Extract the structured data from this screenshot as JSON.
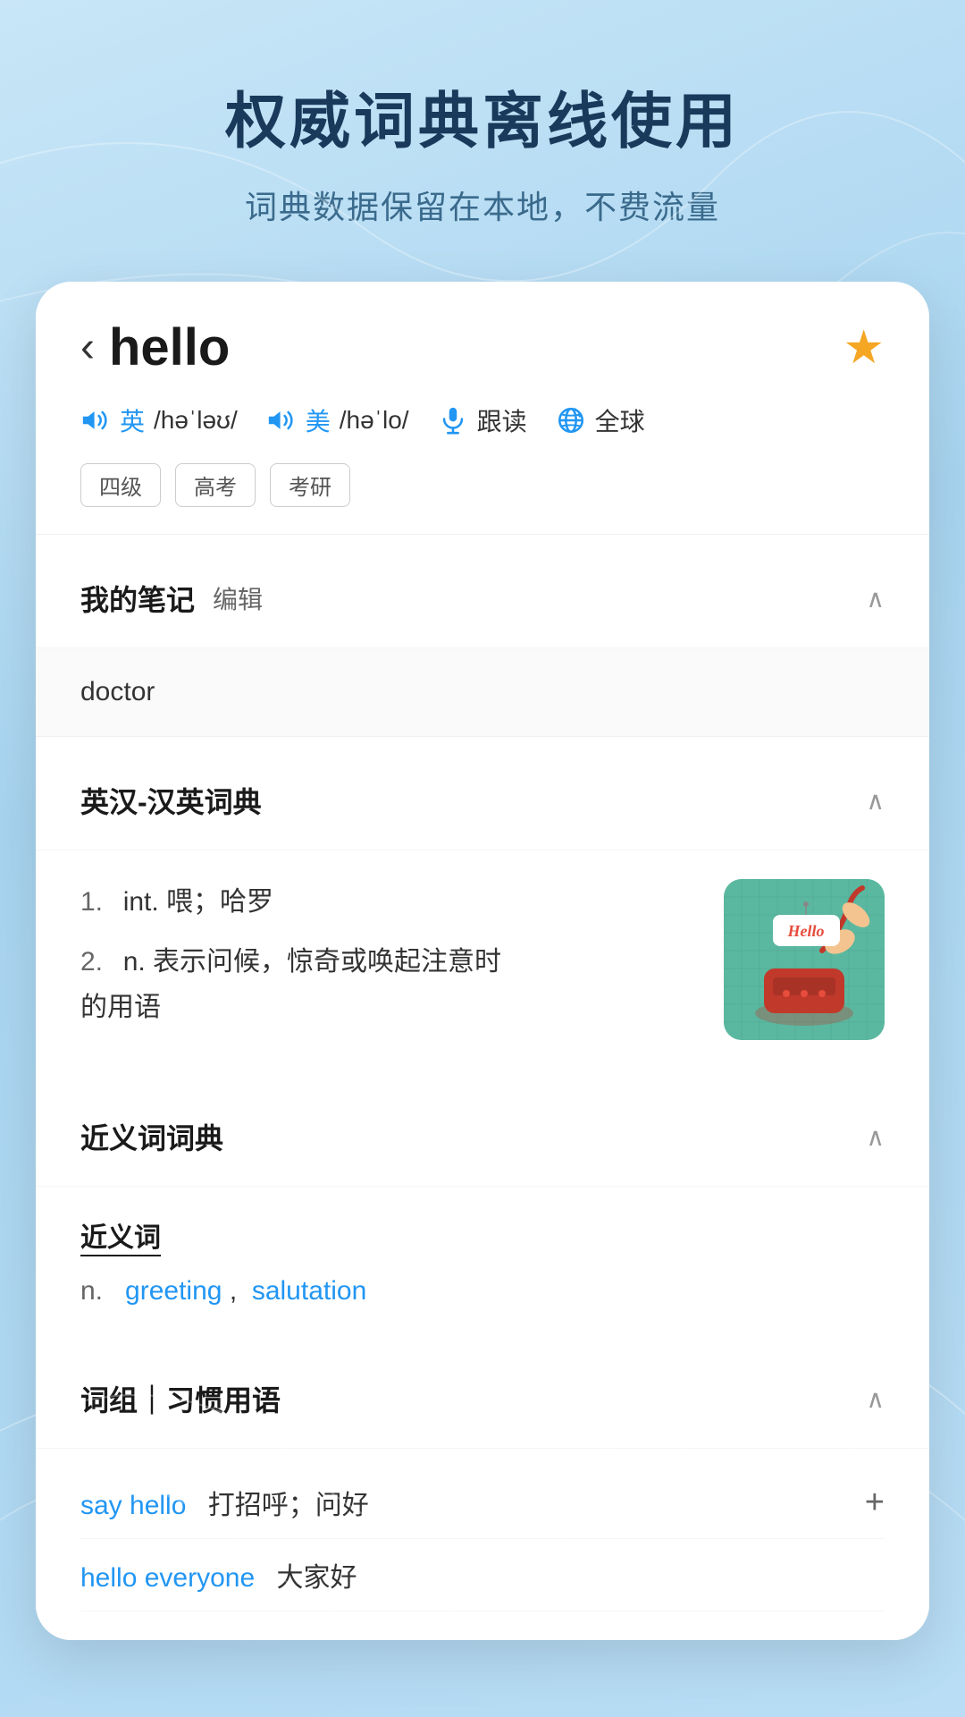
{
  "background": {
    "color_start": "#c8e6f7",
    "color_end": "#a8d4f0"
  },
  "header": {
    "main_title": "权威词典离线使用",
    "sub_title": "词典数据保留在本地，不费流量"
  },
  "word_card": {
    "back_label": "‹",
    "word": "hello",
    "star_icon": "★",
    "pronunciation": {
      "uk_label": "英",
      "uk_phonetic": "/həˈləʊ/",
      "us_label": "美",
      "us_phonetic": "/həˈlo/",
      "follow_read_label": "跟读",
      "global_label": "全球"
    },
    "tags": [
      "四级",
      "高考",
      "考研"
    ],
    "sections": {
      "notes": {
        "title": "我的笔记",
        "edit_label": "编辑",
        "content": "doctor"
      },
      "en_zh_dict": {
        "title": "英汉-汉英词典",
        "definitions": [
          {
            "num": "1.",
            "pos": "int.",
            "text": "喂；哈罗"
          },
          {
            "num": "2.",
            "pos": "n.",
            "text": "表示问候，惊奇或唤起注意时的用语"
          }
        ]
      },
      "synonym": {
        "title": "近义词词典",
        "section_label": "近义词",
        "entries": [
          {
            "pos": "n.",
            "words": [
              "greeting",
              "salutation"
            ]
          }
        ]
      },
      "phrases": {
        "title": "词组｜习惯用语",
        "items": [
          {
            "en": "say hello",
            "zh": "打招呼；问好"
          },
          {
            "en": "hello everyone",
            "zh": "大家好"
          }
        ]
      }
    }
  }
}
